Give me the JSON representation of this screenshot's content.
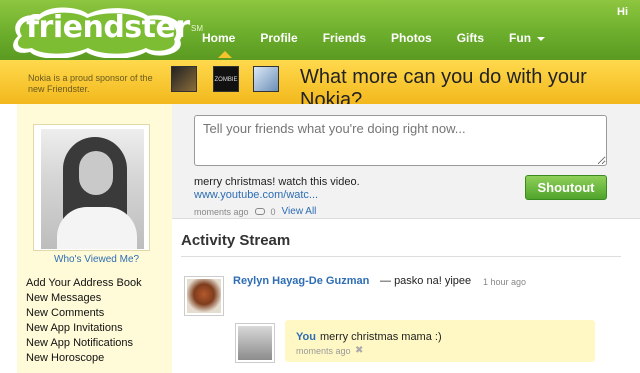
{
  "header": {
    "logo": "friendster",
    "tm": "SM",
    "greeting": "Hi",
    "nav": [
      {
        "label": "Home"
      },
      {
        "label": "Profile"
      },
      {
        "label": "Friends"
      },
      {
        "label": "Photos"
      },
      {
        "label": "Gifts"
      },
      {
        "label": "Fun"
      }
    ]
  },
  "banner": {
    "sponsor": "Nokia is a proud sponsor of the new Friendster.",
    "ad2": "ZOMBIE",
    "headline": "What more can you do with your Nokia?"
  },
  "sidebar": {
    "viewed_link": "Who's Viewed Me?",
    "menu": [
      "Add Your Address Book",
      "New Messages",
      "New Comments",
      "New App Invitations",
      "New App Notifications",
      "New Horoscope"
    ]
  },
  "status": {
    "placeholder": "Tell your friends what you're doing right now...",
    "current_text": "merry christmas! watch this video.",
    "current_link": "www.youtube.com/watc...",
    "meta_time": "moments ago",
    "comment_count": "0",
    "view_all": "View All",
    "button_label": "Shoutout"
  },
  "activity": {
    "title": "Activity Stream",
    "post": {
      "author": "Reylyn Hayag-De Guzman",
      "separator": "—",
      "text": "pasko na! yipee",
      "time": "1 hour ago"
    },
    "comment": {
      "author": "You",
      "text": "merry christmas mama :)",
      "time": "moments ago"
    }
  },
  "colors": {
    "header_green": "#6aac2b",
    "banner_yellow": "#f2b81c",
    "link_blue": "#2e6db4",
    "button_green": "#4fa32b"
  }
}
